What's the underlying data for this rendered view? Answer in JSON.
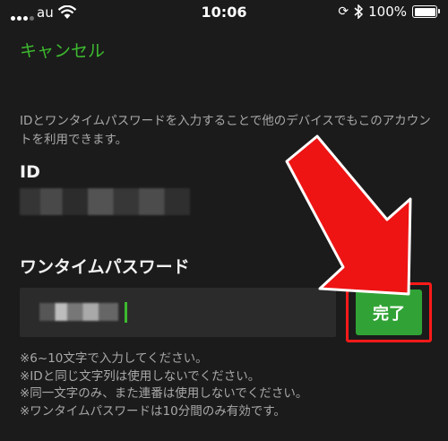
{
  "status_bar": {
    "carrier": "au",
    "time": "10:06",
    "battery": "100%"
  },
  "nav": {
    "cancel_label": "キャンセル"
  },
  "form": {
    "description": "IDとワンタイムパスワードを入力することで他のデバイスでもこのアカウントを利用できます。",
    "id_label": "ID",
    "otp_label": "ワンタイムパスワード",
    "done_label": "完了",
    "notes": [
      "※6~10文字で入力してください。",
      "※IDと同じ文字列は使用しないでください。",
      "※同一文字のみ、また連番は使用しないでください。",
      "※ワンタイムパスワードは10分間のみ有効です。"
    ]
  },
  "colors": {
    "accent_green": "#3dba2f",
    "button_green": "#31a336",
    "annotation_red": "#ff1a1a",
    "background": "#1b1b1b"
  },
  "icons": [
    "signal-icon",
    "wifi-icon",
    "rotation-lock-icon",
    "bluetooth-icon",
    "battery-icon",
    "annotation-arrow"
  ]
}
